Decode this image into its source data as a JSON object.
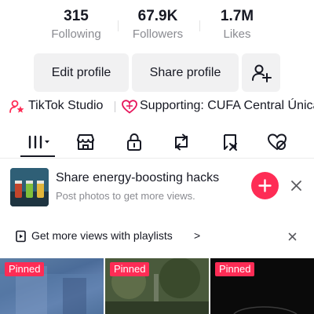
{
  "stats": [
    {
      "value": "315",
      "label": "Following"
    },
    {
      "value": "67.9K",
      "label": "Followers"
    },
    {
      "value": "1.7M",
      "label": "Likes"
    }
  ],
  "buttons": {
    "edit_profile": "Edit profile",
    "share_profile": "Share profile",
    "add_friend_icon": "add-user-icon"
  },
  "meta": {
    "studio_label": "TikTok Studio",
    "supporting_label": "Supporting: CUFA Central Única"
  },
  "tabs": [
    {
      "icon": "grid-icon",
      "selected": true
    },
    {
      "icon": "shop-icon",
      "selected": false
    },
    {
      "icon": "lock-icon",
      "selected": false
    },
    {
      "icon": "repost-icon",
      "selected": false
    },
    {
      "icon": "saved-icon",
      "selected": false
    },
    {
      "icon": "liked-icon",
      "selected": false
    }
  ],
  "promo": {
    "title": "Share energy-boosting hacks",
    "subtitle": "Post photos to get more views."
  },
  "playlist_bar": {
    "label": "Get more views with playlists",
    "chevron": ">"
  },
  "videos": [
    {
      "badge": "Pinned"
    },
    {
      "badge": "Pinned"
    },
    {
      "badge": "Pinned"
    }
  ],
  "colors": {
    "accent": "#fe2c55",
    "text": "#161823",
    "muted": "#8a8b91",
    "button_bg": "#f1f1f2"
  }
}
